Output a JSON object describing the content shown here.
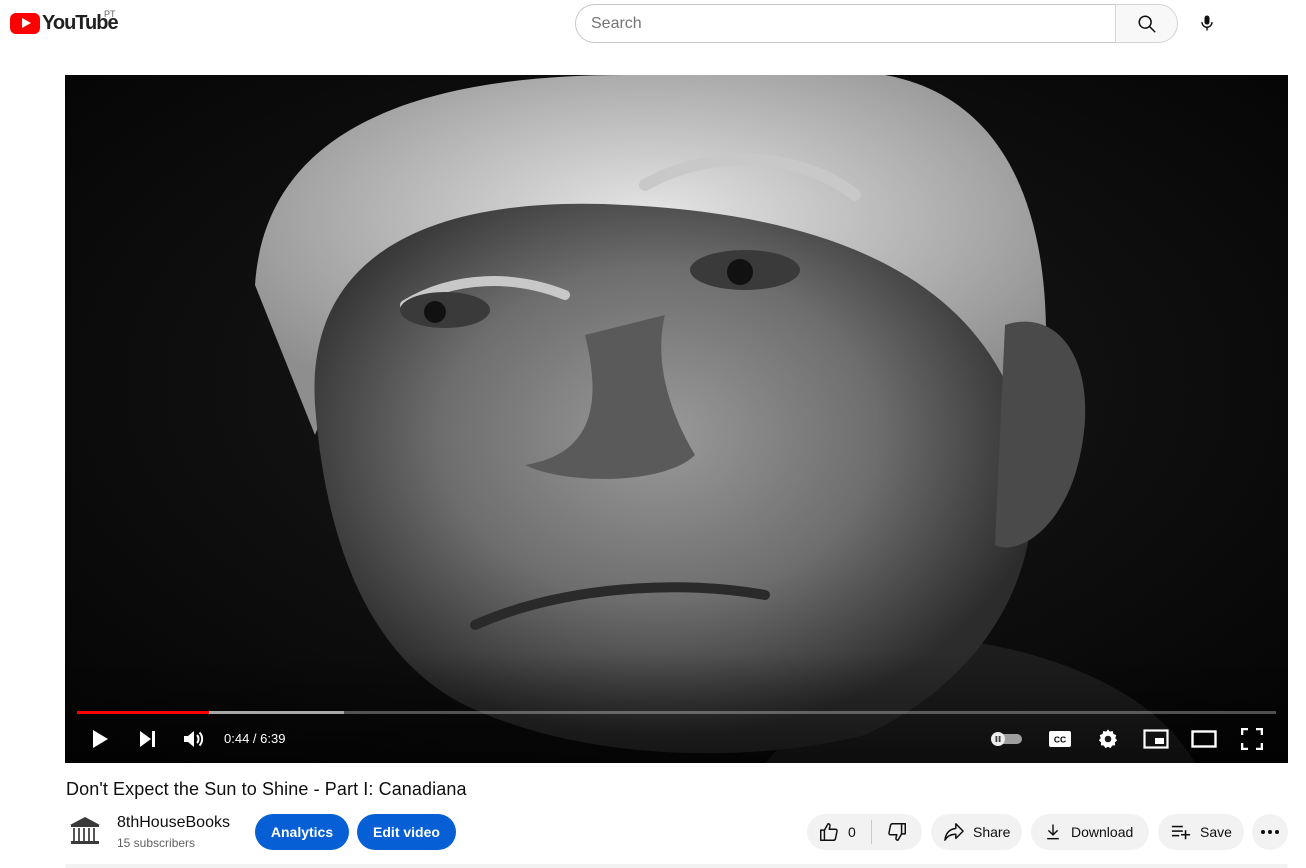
{
  "header": {
    "logo_text": "YouTube",
    "country_code": "PT",
    "search_placeholder": "Search"
  },
  "player": {
    "time_display": "0:44 / 6:39",
    "progress_played": 0.11,
    "progress_buffered": 0.223,
    "accent_color": "#ff0000"
  },
  "video": {
    "title": "Don't Expect the Sun to Shine - Part I: Canadiana"
  },
  "channel": {
    "name": "8thHouseBooks",
    "subscribers": "15 subscribers"
  },
  "actions": {
    "analytics_label": "Analytics",
    "edit_video_label": "Edit video",
    "like_count": "0",
    "share_label": "Share",
    "download_label": "Download",
    "save_label": "Save"
  },
  "colors": {
    "brand_red": "#ff0000",
    "primary_blue": "#065fd4",
    "chip_grey": "#f2f2f2"
  }
}
